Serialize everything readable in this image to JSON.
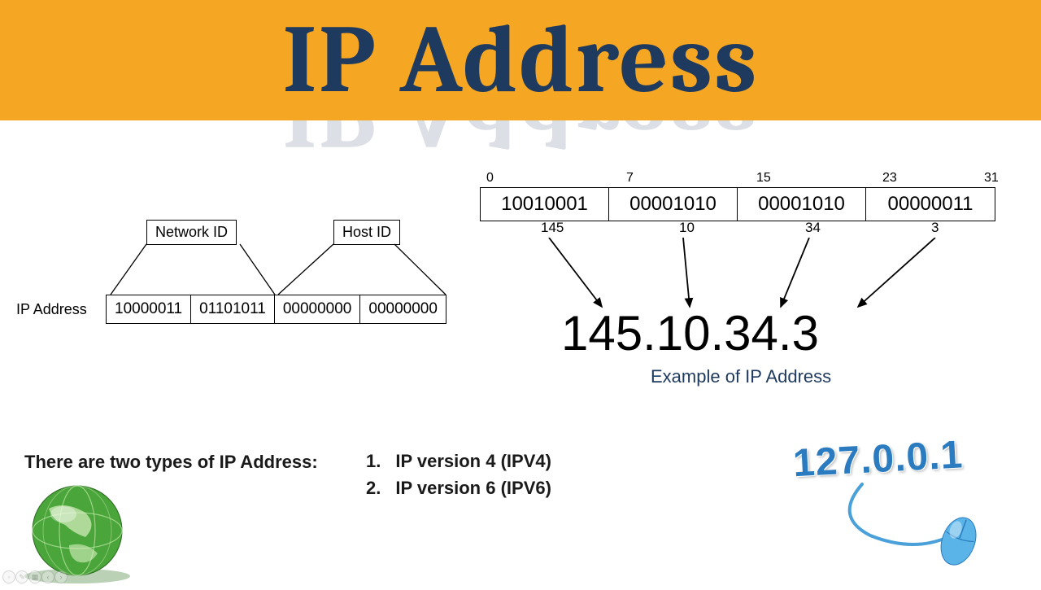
{
  "banner": {
    "title": "IP Address"
  },
  "left": {
    "label": "IP Address",
    "network_id": "Network ID",
    "host_id": "Host ID",
    "octets": [
      "10000011",
      "01101011",
      "00000000",
      "00000000"
    ]
  },
  "right": {
    "bit_positions": [
      "0",
      "7",
      "15",
      "23",
      "31"
    ],
    "octets": [
      "10010001",
      "00001010",
      "00001010",
      "00000011"
    ],
    "decimals": [
      "145",
      "10",
      "34",
      "3"
    ],
    "ip": "145.10.34.3",
    "example": "Example of IP Address"
  },
  "types": {
    "heading": "There are two types of IP Address:",
    "items": [
      {
        "num": "1.",
        "text": "IP version 4 (IPV4)"
      },
      {
        "num": "2.",
        "text": "IP version 6 (IPV6)"
      }
    ]
  },
  "localhost": {
    "ip": "127.0.0.1"
  }
}
